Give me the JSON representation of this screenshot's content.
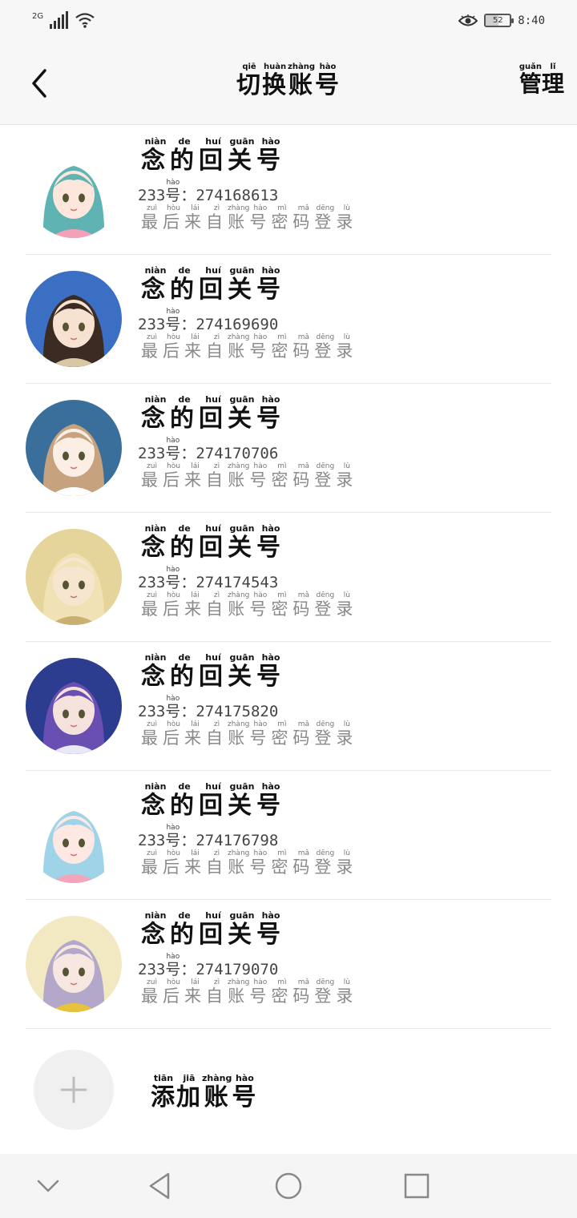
{
  "status_bar": {
    "network": "2G",
    "battery": "52",
    "battery_level": 0.52,
    "time": "8:40"
  },
  "header": {
    "title_chars": [
      {
        "c": "切",
        "p": "qiē"
      },
      {
        "c": "换",
        "p": "huàn"
      },
      {
        "c": "账",
        "p": "zhàng"
      },
      {
        "c": "号",
        "p": "hào"
      }
    ],
    "manage_chars": [
      {
        "c": "管",
        "p": "guǎn"
      },
      {
        "c": "理",
        "p": "lǐ"
      }
    ]
  },
  "accounts": [
    {
      "name": "念的回关号",
      "id_prefix": "233",
      "id_label": "号",
      "id_label_pinyin": "hào",
      "id_value": "：274168613",
      "avatar": "avatar-1"
    },
    {
      "name": "念的回关号",
      "id_prefix": "233",
      "id_label": "号",
      "id_label_pinyin": "hào",
      "id_value": "：274169690",
      "avatar": "avatar-2"
    },
    {
      "name": "念的回关号",
      "id_prefix": "233",
      "id_label": "号",
      "id_label_pinyin": "hào",
      "id_value": "：274170706",
      "avatar": "avatar-3"
    },
    {
      "name": "念的回关号",
      "id_prefix": "233",
      "id_label": "号",
      "id_label_pinyin": "hào",
      "id_value": "：274174543",
      "avatar": "avatar-4"
    },
    {
      "name": "念的回关号",
      "id_prefix": "233",
      "id_label": "号",
      "id_label_pinyin": "hào",
      "id_value": "：274175820",
      "avatar": "avatar-5"
    },
    {
      "name": "念的回关号",
      "id_prefix": "233",
      "id_label": "号",
      "id_label_pinyin": "hào",
      "id_value": "：274176798",
      "avatar": "avatar-6"
    },
    {
      "name": "念的回关号",
      "id_prefix": "233",
      "id_label": "号",
      "id_label_pinyin": "hào",
      "id_value": "：274179070",
      "avatar": "avatar-7"
    }
  ],
  "name_chars": [
    {
      "c": "念",
      "p": "niàn"
    },
    {
      "c": "的",
      "p": "de"
    },
    {
      "c": "回",
      "p": "huí"
    },
    {
      "c": "关",
      "p": "guān"
    },
    {
      "c": "号",
      "p": "hào"
    }
  ],
  "last_login_chars": [
    {
      "c": "最",
      "p": "zuì"
    },
    {
      "c": "后",
      "p": "hòu"
    },
    {
      "c": "来",
      "p": "lái"
    },
    {
      "c": "自",
      "p": "zì"
    },
    {
      "c": "账",
      "p": "zhàng"
    },
    {
      "c": "号",
      "p": "hào"
    },
    {
      "c": "密",
      "p": "mì"
    },
    {
      "c": "码",
      "p": "mǎ"
    },
    {
      "c": "登",
      "p": "dēng"
    },
    {
      "c": "录",
      "p": "lù"
    }
  ],
  "add_account": {
    "label_chars": [
      {
        "c": "添",
        "p": "tiān"
      },
      {
        "c": "加",
        "p": "jiā"
      },
      {
        "c": "账",
        "p": "zhàng"
      },
      {
        "c": "号",
        "p": "hào"
      }
    ]
  },
  "nav": {
    "icons": [
      "chevron-down-icon",
      "back-triangle-icon",
      "home-circle-icon",
      "recents-square-icon"
    ]
  },
  "colors": {
    "status_bg": "#f7f7f7",
    "divider": "#e8e8e8",
    "secondary_text": "#8a8a8a",
    "add_circle": "#f0f0f0"
  }
}
